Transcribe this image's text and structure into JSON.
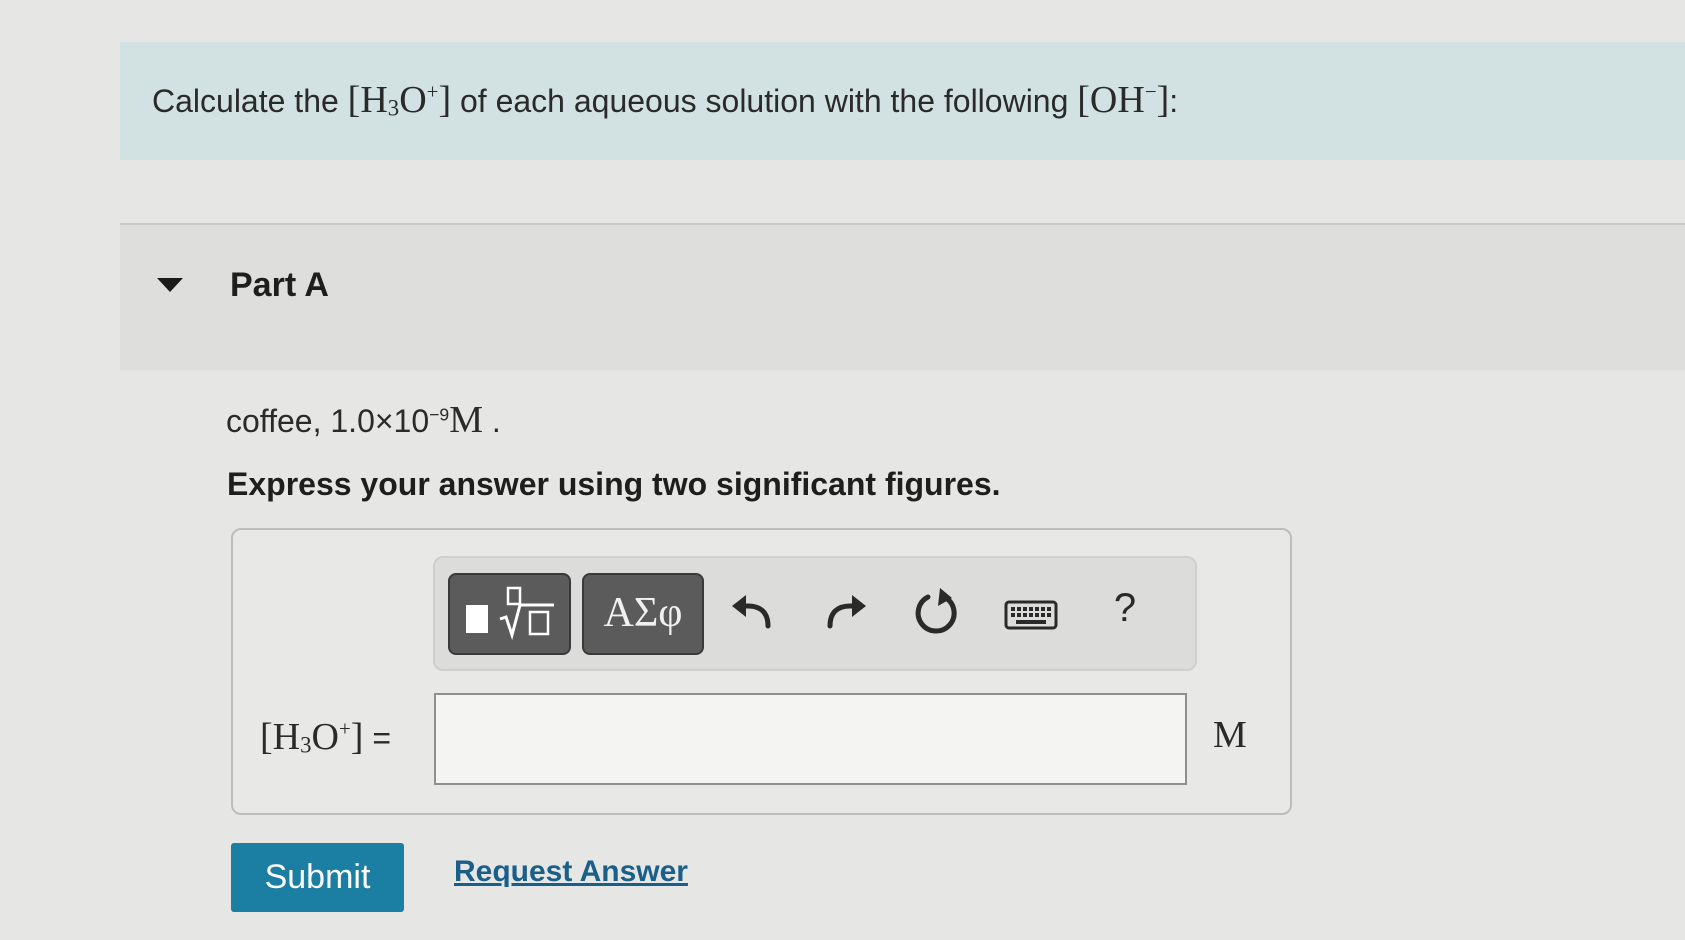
{
  "question": {
    "before": "Calculate the ",
    "chem_open": "[H",
    "chem_sub": "3",
    "chem_o": "O",
    "chem_charge": "+",
    "chem_close": "]",
    "middle": " of each aqueous solution with the following ",
    "oh_open": "[OH",
    "oh_charge": "−",
    "oh_close": "]",
    "after": ":"
  },
  "part": {
    "title": "Part A",
    "expanded": true
  },
  "prompt": {
    "solution": "coffee, ",
    "mantissa": "1.0×10",
    "exponent": "−9",
    "unit": "M",
    "end": "."
  },
  "instruction": "Express your answer using two significant figures.",
  "toolbar": {
    "greek_label": "ΑΣφ",
    "help_label": "?",
    "buttons": [
      "templates",
      "greek-symbols",
      "undo",
      "redo",
      "reset",
      "keyboard",
      "help"
    ]
  },
  "answer": {
    "lhs_open": "[H",
    "lhs_sub": "3",
    "lhs_o": "O",
    "lhs_charge": "+",
    "lhs_close": "]",
    "equals": " =",
    "value": "",
    "unit": "M"
  },
  "actions": {
    "submit_label": "Submit",
    "request_label": "Request Answer",
    "submit_color": "#1a7fa3"
  }
}
